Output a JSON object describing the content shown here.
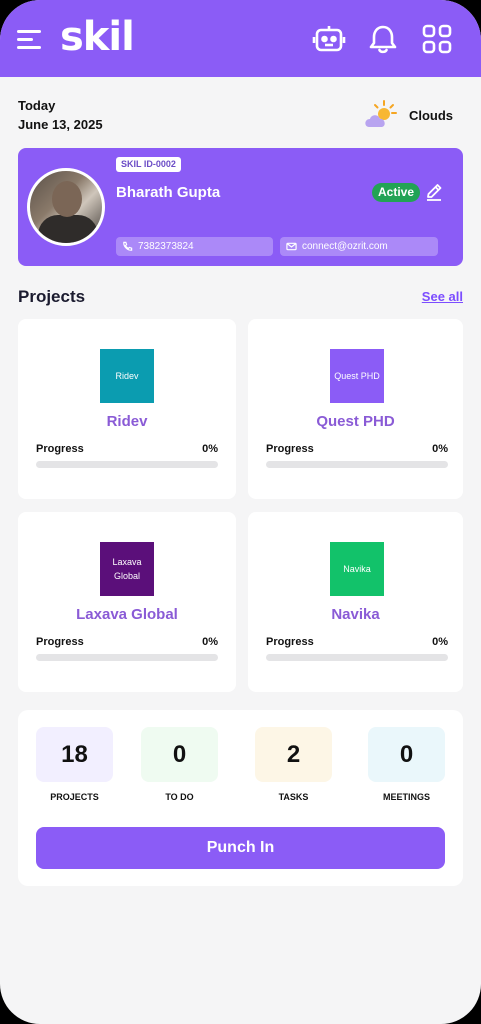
{
  "header": {
    "logo": "skil",
    "bg_color": "#8b5cf6",
    "icons": [
      "menu-icon",
      "robot-icon",
      "bell-icon",
      "grid-icon"
    ]
  },
  "date_block": {
    "today_label": "Today",
    "date": "June 13, 2025"
  },
  "weather": {
    "label": "Clouds",
    "icon": "partly-cloudy-icon"
  },
  "profile": {
    "skil_id": "SKIL ID-0002",
    "name": "Bharath Gupta",
    "status": "Active",
    "phone": "7382373824",
    "email": "connect@ozrit.com"
  },
  "projects": {
    "title": "Projects",
    "see_all": "See all",
    "items": [
      {
        "thumb_text": "Ridev",
        "name": "Ridev",
        "progress_label": "Progress",
        "progress_text": "0%",
        "progress": 0,
        "color": "#0b9cb0"
      },
      {
        "thumb_text": "Quest PHD",
        "name": "Quest PHD",
        "progress_label": "Progress",
        "progress_text": "0%",
        "progress": 0,
        "color": "#8b5cf6"
      },
      {
        "thumb_text": "Laxava Global",
        "name": "Laxava Global",
        "progress_label": "Progress",
        "progress_text": "0%",
        "progress": 0,
        "color": "#5b0f7a"
      },
      {
        "thumb_text": "Navika",
        "name": "Navika",
        "progress_label": "Progress",
        "progress_text": "0%",
        "progress": 0,
        "color": "#12c26a"
      }
    ]
  },
  "stats": {
    "items": [
      {
        "value": "18",
        "label": "PROJECTS",
        "bg": "#f2efff"
      },
      {
        "value": "0",
        "label": "TO DO",
        "bg": "#effbf1"
      },
      {
        "value": "2",
        "label": "TASKS",
        "bg": "#fdf6e6"
      },
      {
        "value": "0",
        "label": "MEETINGS",
        "bg": "#eaf7fb"
      }
    ],
    "punch_label": "Punch In"
  }
}
